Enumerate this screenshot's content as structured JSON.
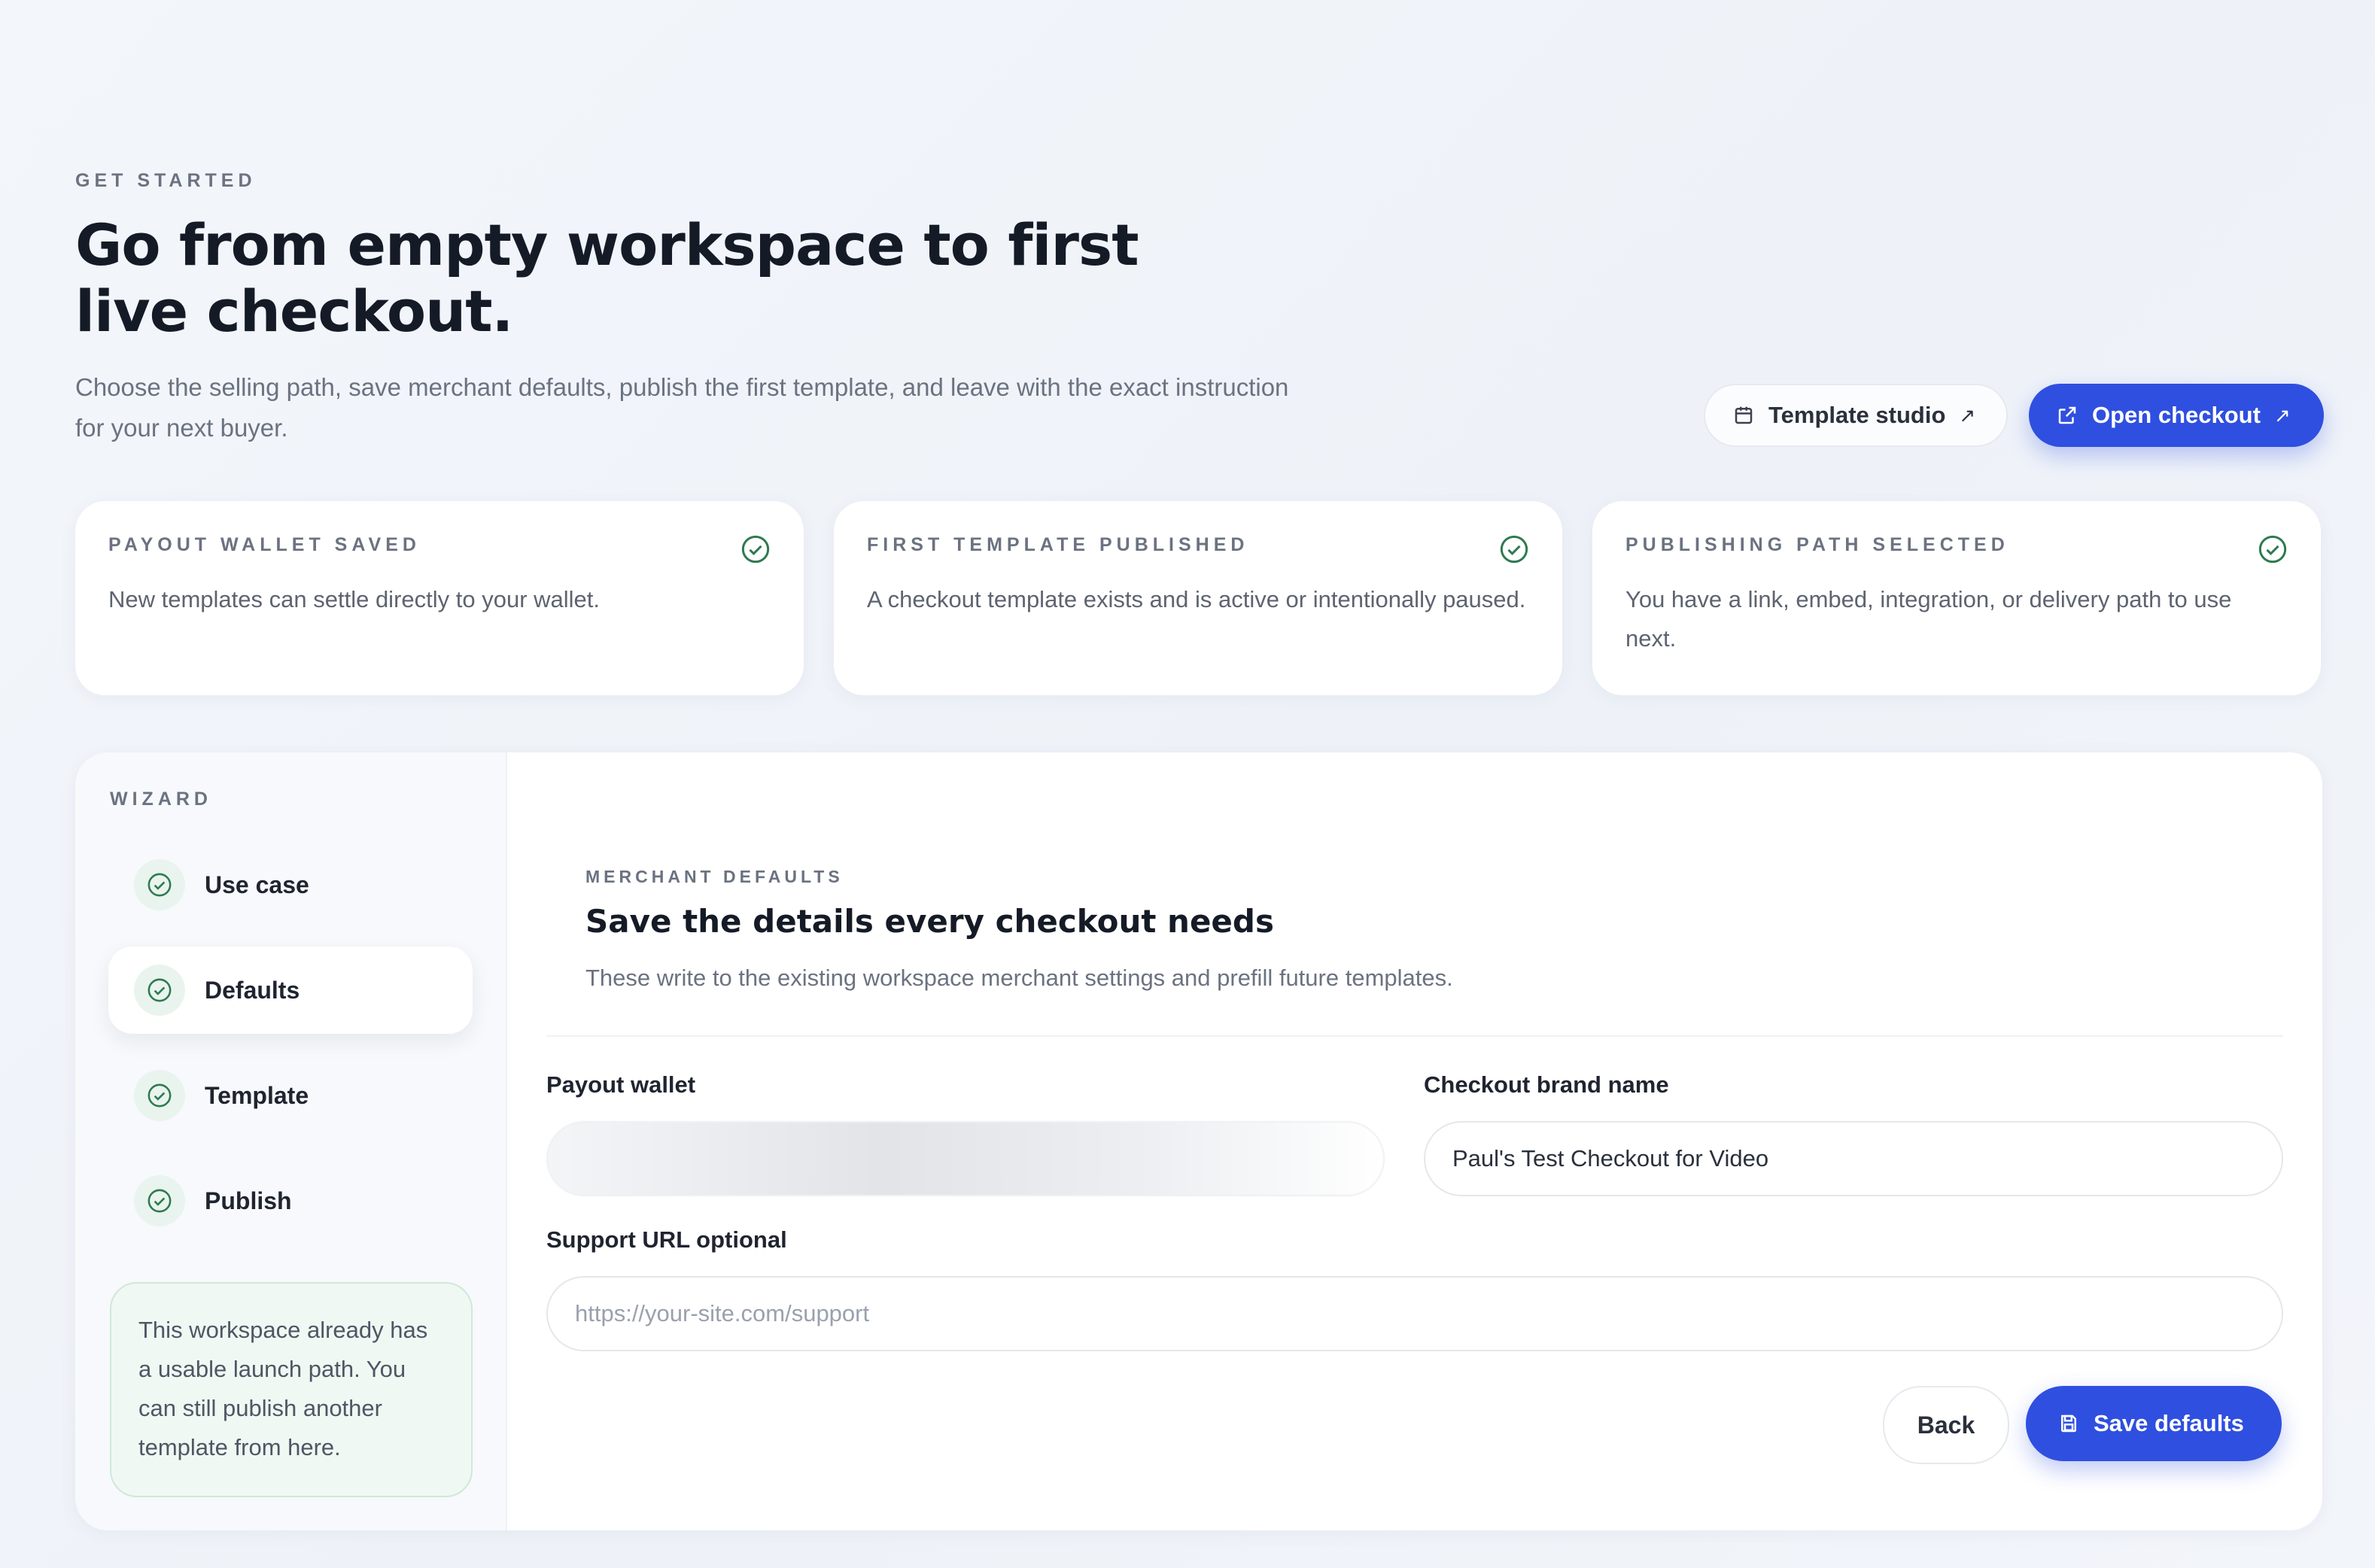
{
  "hero": {
    "eyebrow": "GET STARTED",
    "title": "Go from empty workspace to first live checkout.",
    "subtitle": "Choose the selling path, save merchant defaults, publish the first template, and leave with the exact instruction for your next buyer."
  },
  "actions": {
    "template_studio": "Template studio",
    "open_checkout": "Open checkout",
    "arrow": "↗"
  },
  "status_cards": [
    {
      "label": "PAYOUT WALLET SAVED",
      "desc": "New templates can settle directly to your wallet."
    },
    {
      "label": "FIRST TEMPLATE PUBLISHED",
      "desc": "A checkout template exists and is active or intentionally paused."
    },
    {
      "label": "PUBLISHING PATH SELECTED",
      "desc": "You have a link, embed, integration, or delivery path to use next."
    }
  ],
  "wizard": {
    "label": "WIZARD",
    "steps": [
      {
        "name": "Use case"
      },
      {
        "name": "Defaults"
      },
      {
        "name": "Template"
      },
      {
        "name": "Publish"
      }
    ],
    "active_step": "Defaults",
    "note": "This workspace already has a usable launch path. You can still publish another template from here."
  },
  "form": {
    "eyebrow": "MERCHANT DEFAULTS",
    "title": "Save the details every checkout needs",
    "subtitle": "These write to the existing workspace merchant settings and prefill future templates.",
    "payout_wallet_label": "Payout wallet",
    "brand_name_label": "Checkout brand name",
    "brand_name_value": "Paul's Test Checkout for Video",
    "support_url_label": "Support URL optional",
    "support_url_placeholder": "https://your-site.com/support",
    "back_label": "Back",
    "save_label": "Save defaults"
  },
  "colors": {
    "accent": "#2f4fe0",
    "success": "#2f7a50",
    "note_bg": "#f0f8f3"
  }
}
